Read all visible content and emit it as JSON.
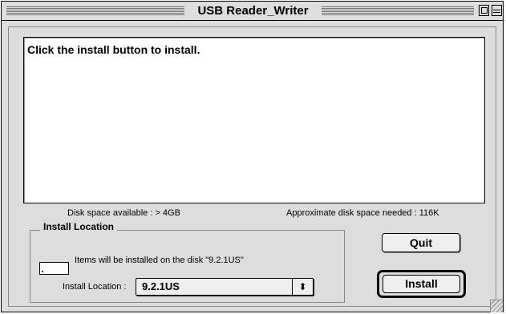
{
  "window": {
    "title": "USB Reader_Writer"
  },
  "message": {
    "text": "Click the install  button to install."
  },
  "disk": {
    "available": "Disk space available : > 4GB",
    "needed": "Approximate disk space needed : 116K"
  },
  "install_location": {
    "group_label": "Install Location",
    "items_text": "Items will be installed on the disk \"9.2.1US\"",
    "field_label": "Install Location :",
    "selected": "9.2.1US"
  },
  "buttons": {
    "quit": "Quit",
    "install": "Install"
  },
  "colors": {
    "window_bg": "#dddddd",
    "content_bg": "#ffffff"
  },
  "icons": {
    "popup_arrows": "up-down-arrows-icon",
    "disk": "disk-icon"
  }
}
